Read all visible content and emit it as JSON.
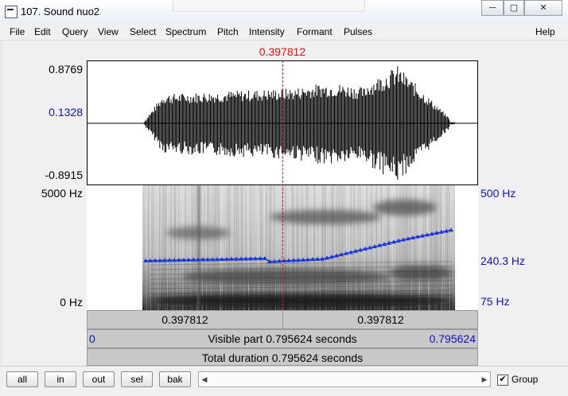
{
  "window": {
    "title": "107. Sound nuo2",
    "minimize": "─",
    "maximize": "▢",
    "close": "✕"
  },
  "menu": [
    "File",
    "Edit",
    "Query",
    "View",
    "Select",
    "Spectrum",
    "Pitch",
    "Intensity",
    "Formant",
    "Pulses",
    "Help"
  ],
  "cursor": {
    "time_label": "0.397812"
  },
  "waveform": {
    "top": "0.8769",
    "cursor_value": "0.1328",
    "bottom": "-0.8915"
  },
  "spectrogram": {
    "top": "5000 Hz",
    "bottom": "0 Hz"
  },
  "pitch": {
    "top": "500 Hz",
    "cursor": "240.3 Hz",
    "bottom": "75 Hz"
  },
  "selection": {
    "left": "0.397812",
    "right": "0.397812"
  },
  "visible": {
    "start": "0",
    "label": "Visible part 0.795624 seconds",
    "end": "0.795624"
  },
  "total": {
    "label": "Total duration 0.795624 seconds"
  },
  "toolbar": {
    "all": "all",
    "in": "in",
    "out": "out",
    "sel": "sel",
    "bak": "bak",
    "group": "Group",
    "group_checked": "✔"
  },
  "colors": {
    "cursor": "#e01010",
    "pitch": "#1a36d8",
    "axis_blue": "#1010c0"
  }
}
